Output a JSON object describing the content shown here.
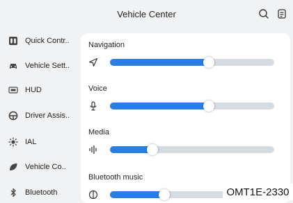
{
  "header": {
    "title": "Vehicle Center",
    "search_icon": "search-icon",
    "notes_icon": "notes-icon"
  },
  "sidebar": {
    "items": [
      {
        "label": "Quick Contr..",
        "icon": "quick-control-icon"
      },
      {
        "label": "Vehicle Sett..",
        "icon": "car-icon"
      },
      {
        "label": "HUD",
        "icon": "hud-icon"
      },
      {
        "label": "Driver Assis..",
        "icon": "steering-wheel-icon"
      },
      {
        "label": "IAL",
        "icon": "ambient-light-icon"
      },
      {
        "label": "Vehicle Co..",
        "icon": "leaf-icon"
      },
      {
        "label": "Bluetooth",
        "icon": "bluetooth-icon"
      }
    ]
  },
  "volume": {
    "sections": [
      {
        "label": "Navigation",
        "icon": "navigation-arrow-icon",
        "level": 0.6
      },
      {
        "label": "Voice",
        "icon": "microphone-icon",
        "level": 0.6
      },
      {
        "label": "Media",
        "icon": "audio-wave-icon",
        "level": 0.26
      },
      {
        "label": "Bluetooth music",
        "icon": "bluetooth-music-icon",
        "level": 0.33
      }
    ]
  },
  "watermark": {
    "text": "OMT1E-2330"
  },
  "colors": {
    "accent": "#2a7de1",
    "track": "#d6dbe2",
    "background": "#f1f2f4",
    "panel": "#ffffff"
  }
}
